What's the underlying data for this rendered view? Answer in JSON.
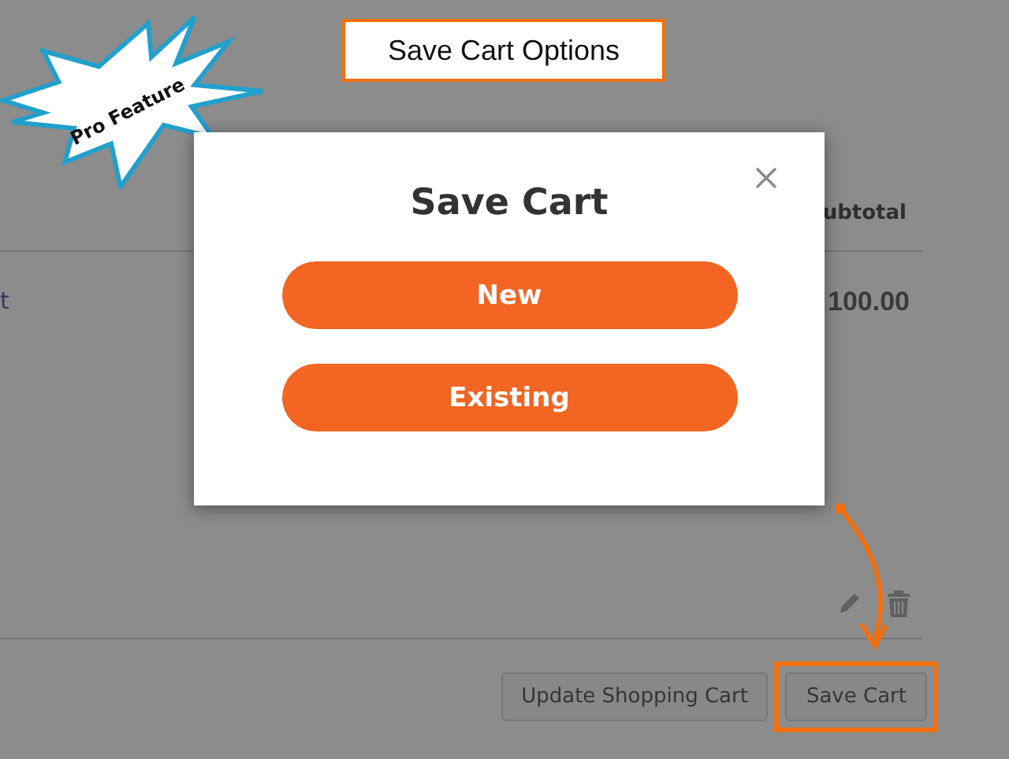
{
  "badge": {
    "label": "Pro Feature"
  },
  "callout": {
    "title": "Save Cart Options"
  },
  "cart": {
    "column_heading": "ubtotal",
    "rows": [
      {
        "column_1": "t",
        "subtotal": "100.00"
      }
    ],
    "actions": [
      {
        "label": "Update Shopping Cart",
        "highlighted": false
      },
      {
        "label": "Save Cart",
        "highlighted": true
      }
    ]
  },
  "modal": {
    "title": "Save Cart",
    "options": [
      "New",
      "Existing"
    ]
  }
}
